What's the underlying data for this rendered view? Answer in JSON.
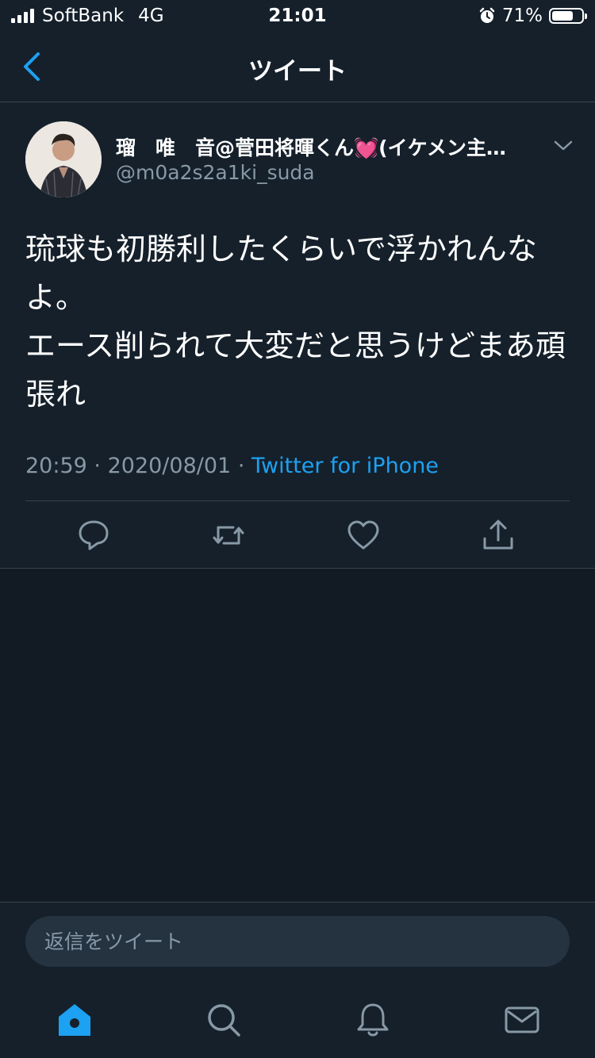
{
  "status_bar": {
    "carrier": "SoftBank",
    "network": "4G",
    "time": "21:01",
    "battery_percent": "71%",
    "battery_level": 0.71
  },
  "header": {
    "title": "ツイート",
    "back_icon": "chevron-left-icon"
  },
  "tweet": {
    "display_name": "瑠　唯　音@菅田将暉くん",
    "display_name_emoji": "💓",
    "display_name_suffix": "(イケメン主…",
    "handle": "@m0a2s2a1ki_suda",
    "text": "琉球も初勝利したくらいで浮かれんなよ。\nエース削られて大変だと思うけどまあ頑張れ",
    "time": "20:59",
    "date": "2020/08/01",
    "separator": "·",
    "source": "Twitter for iPhone",
    "actions": [
      "reply-icon",
      "retweet-icon",
      "like-icon",
      "share-icon"
    ]
  },
  "reply": {
    "placeholder": "返信をツイート"
  },
  "tab_bar": {
    "tabs": [
      "home-icon",
      "search-icon",
      "notifications-icon",
      "messages-icon"
    ],
    "active_color": "#1da1f2"
  },
  "colors": {
    "background": "#15202b",
    "accent": "#1da1f2",
    "secondary_text": "#8899a6",
    "divider": "#38444d"
  }
}
